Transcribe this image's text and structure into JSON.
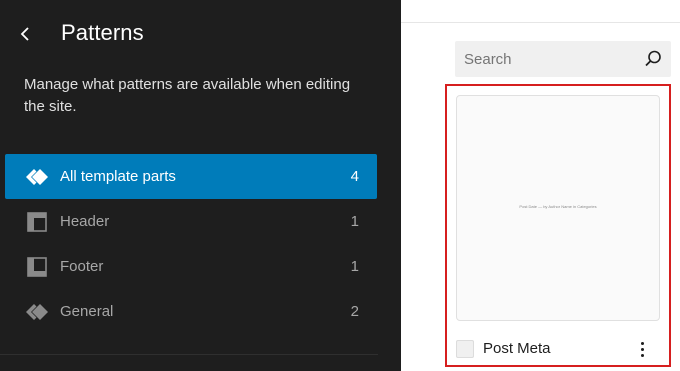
{
  "sidebar": {
    "title": "Patterns",
    "description": "Manage what patterns are available when editing the site.",
    "items": [
      {
        "label": "All template parts",
        "count": "4",
        "icon": "template-parts-icon",
        "active": true
      },
      {
        "label": "Header",
        "count": "1",
        "icon": "header-icon",
        "active": false
      },
      {
        "label": "Footer",
        "count": "1",
        "icon": "footer-icon",
        "active": false
      },
      {
        "label": "General",
        "count": "2",
        "icon": "template-parts-icon",
        "active": false
      }
    ]
  },
  "search": {
    "placeholder": "Search",
    "value": ""
  },
  "card": {
    "title": "Post Meta",
    "preview_text": "Post Date — by Author Name in Categories"
  },
  "colors": {
    "sidebar_bg": "#1e1e1e",
    "accent": "#007cba",
    "highlight": "#d61f1f"
  }
}
